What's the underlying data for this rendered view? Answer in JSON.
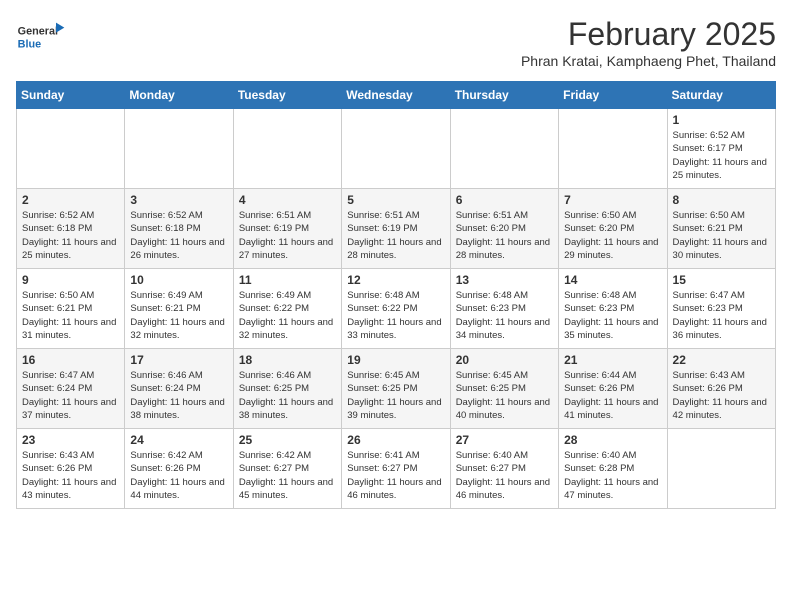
{
  "header": {
    "logo_line1": "General",
    "logo_line2": "Blue",
    "month": "February 2025",
    "location": "Phran Kratai, Kamphaeng Phet, Thailand"
  },
  "weekdays": [
    "Sunday",
    "Monday",
    "Tuesday",
    "Wednesday",
    "Thursday",
    "Friday",
    "Saturday"
  ],
  "weeks": [
    [
      {
        "day": "",
        "info": ""
      },
      {
        "day": "",
        "info": ""
      },
      {
        "day": "",
        "info": ""
      },
      {
        "day": "",
        "info": ""
      },
      {
        "day": "",
        "info": ""
      },
      {
        "day": "",
        "info": ""
      },
      {
        "day": "1",
        "info": "Sunrise: 6:52 AM\nSunset: 6:17 PM\nDaylight: 11 hours\nand 25 minutes."
      }
    ],
    [
      {
        "day": "2",
        "info": "Sunrise: 6:52 AM\nSunset: 6:18 PM\nDaylight: 11 hours\nand 25 minutes."
      },
      {
        "day": "3",
        "info": "Sunrise: 6:52 AM\nSunset: 6:18 PM\nDaylight: 11 hours\nand 26 minutes."
      },
      {
        "day": "4",
        "info": "Sunrise: 6:51 AM\nSunset: 6:19 PM\nDaylight: 11 hours\nand 27 minutes."
      },
      {
        "day": "5",
        "info": "Sunrise: 6:51 AM\nSunset: 6:19 PM\nDaylight: 11 hours\nand 28 minutes."
      },
      {
        "day": "6",
        "info": "Sunrise: 6:51 AM\nSunset: 6:20 PM\nDaylight: 11 hours\nand 28 minutes."
      },
      {
        "day": "7",
        "info": "Sunrise: 6:50 AM\nSunset: 6:20 PM\nDaylight: 11 hours\nand 29 minutes."
      },
      {
        "day": "8",
        "info": "Sunrise: 6:50 AM\nSunset: 6:21 PM\nDaylight: 11 hours\nand 30 minutes."
      }
    ],
    [
      {
        "day": "9",
        "info": "Sunrise: 6:50 AM\nSunset: 6:21 PM\nDaylight: 11 hours\nand 31 minutes."
      },
      {
        "day": "10",
        "info": "Sunrise: 6:49 AM\nSunset: 6:21 PM\nDaylight: 11 hours\nand 32 minutes."
      },
      {
        "day": "11",
        "info": "Sunrise: 6:49 AM\nSunset: 6:22 PM\nDaylight: 11 hours\nand 32 minutes."
      },
      {
        "day": "12",
        "info": "Sunrise: 6:48 AM\nSunset: 6:22 PM\nDaylight: 11 hours\nand 33 minutes."
      },
      {
        "day": "13",
        "info": "Sunrise: 6:48 AM\nSunset: 6:23 PM\nDaylight: 11 hours\nand 34 minutes."
      },
      {
        "day": "14",
        "info": "Sunrise: 6:48 AM\nSunset: 6:23 PM\nDaylight: 11 hours\nand 35 minutes."
      },
      {
        "day": "15",
        "info": "Sunrise: 6:47 AM\nSunset: 6:23 PM\nDaylight: 11 hours\nand 36 minutes."
      }
    ],
    [
      {
        "day": "16",
        "info": "Sunrise: 6:47 AM\nSunset: 6:24 PM\nDaylight: 11 hours\nand 37 minutes."
      },
      {
        "day": "17",
        "info": "Sunrise: 6:46 AM\nSunset: 6:24 PM\nDaylight: 11 hours\nand 38 minutes."
      },
      {
        "day": "18",
        "info": "Sunrise: 6:46 AM\nSunset: 6:25 PM\nDaylight: 11 hours\nand 38 minutes."
      },
      {
        "day": "19",
        "info": "Sunrise: 6:45 AM\nSunset: 6:25 PM\nDaylight: 11 hours\nand 39 minutes."
      },
      {
        "day": "20",
        "info": "Sunrise: 6:45 AM\nSunset: 6:25 PM\nDaylight: 11 hours\nand 40 minutes."
      },
      {
        "day": "21",
        "info": "Sunrise: 6:44 AM\nSunset: 6:26 PM\nDaylight: 11 hours\nand 41 minutes."
      },
      {
        "day": "22",
        "info": "Sunrise: 6:43 AM\nSunset: 6:26 PM\nDaylight: 11 hours\nand 42 minutes."
      }
    ],
    [
      {
        "day": "23",
        "info": "Sunrise: 6:43 AM\nSunset: 6:26 PM\nDaylight: 11 hours\nand 43 minutes."
      },
      {
        "day": "24",
        "info": "Sunrise: 6:42 AM\nSunset: 6:26 PM\nDaylight: 11 hours\nand 44 minutes."
      },
      {
        "day": "25",
        "info": "Sunrise: 6:42 AM\nSunset: 6:27 PM\nDaylight: 11 hours\nand 45 minutes."
      },
      {
        "day": "26",
        "info": "Sunrise: 6:41 AM\nSunset: 6:27 PM\nDaylight: 11 hours\nand 46 minutes."
      },
      {
        "day": "27",
        "info": "Sunrise: 6:40 AM\nSunset: 6:27 PM\nDaylight: 11 hours\nand 46 minutes."
      },
      {
        "day": "28",
        "info": "Sunrise: 6:40 AM\nSunset: 6:28 PM\nDaylight: 11 hours\nand 47 minutes."
      },
      {
        "day": "",
        "info": ""
      }
    ]
  ]
}
